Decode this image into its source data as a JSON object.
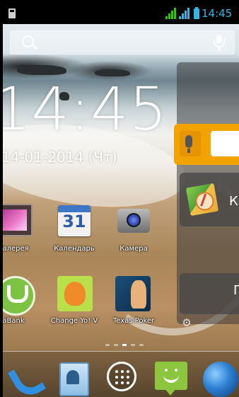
{
  "status_bar": {
    "time": "14:45",
    "accent_color": "#33b5e5",
    "signal_color": "#33c400",
    "icons": [
      "sd-card-icon",
      "signal-1-icon",
      "signal-2-icon",
      "battery-icon"
    ]
  },
  "search_bar": {
    "icons": [
      "search-icon",
      "mic-icon"
    ]
  },
  "clock_widget": {
    "time": "14:45",
    "date": "14-01-2014 (Чт)"
  },
  "side_widgets": {
    "maps_label": "Ка",
    "third_label": "П"
  },
  "apps_row1": [
    {
      "label": "Галерея",
      "icon": "gallery-icon"
    },
    {
      "label": "Календарь",
      "icon": "calendar-icon",
      "day": "31"
    },
    {
      "label": "Камера",
      "icon": "camera-icon"
    }
  ],
  "apps_row2": [
    {
      "label": "aBank",
      "icon": "abank-icon"
    },
    {
      "label": "Change Yo! V",
      "icon": "change-yo-icon"
    },
    {
      "label": "Texas Poker",
      "icon": "texas-poker-icon"
    }
  ],
  "page_indicator": {
    "pages": 5,
    "current": 3
  },
  "dock": [
    "phone-icon",
    "contacts-icon",
    "apps-icon",
    "messaging-icon",
    "browser-icon"
  ]
}
